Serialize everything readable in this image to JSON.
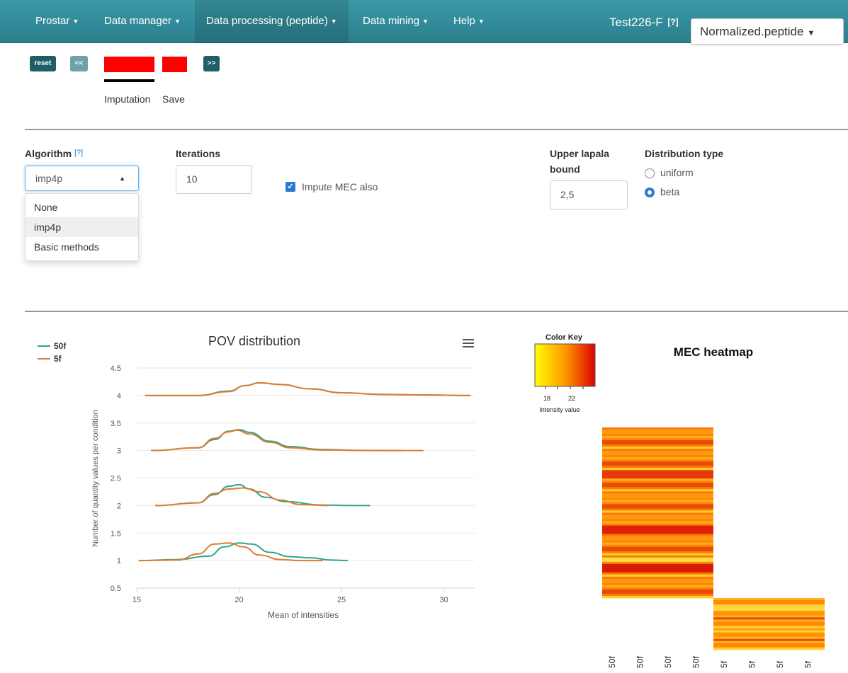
{
  "navbar": {
    "items": [
      {
        "label": "Prostar"
      },
      {
        "label": "Data manager"
      },
      {
        "label": "Data processing (peptide)"
      },
      {
        "label": "Data mining"
      },
      {
        "label": "Help"
      }
    ],
    "project_name": "Test226-F",
    "project_help": "[?]",
    "dataset_selected": "Normalized.peptide",
    "caret_icon": "caret-down-icon"
  },
  "stepper": {
    "reset_label": "reset",
    "prev_label": "<<",
    "next_label": ">>",
    "steps": [
      {
        "label": "Imputation"
      },
      {
        "label": "Save"
      }
    ],
    "colors": {
      "step_active": "#ff0000",
      "button_dark": "#1f5e68",
      "button_light": "#6fa3aa"
    }
  },
  "form": {
    "algorithm": {
      "label": "Algorithm",
      "help": "[?]",
      "value": "imp4p",
      "options": [
        "None",
        "imp4p",
        "Basic methods"
      ]
    },
    "iterations": {
      "label": "Iterations",
      "value": "10"
    },
    "impute_mec": {
      "label": "Impute MEC also",
      "checked": true
    },
    "upper_bound": {
      "label_line1": "Upper lapala",
      "label_line2": "bound",
      "value": "2,5"
    },
    "distribution": {
      "label": "Distribution type",
      "options": [
        {
          "label": "uniform",
          "checked": false
        },
        {
          "label": "beta",
          "checked": true
        }
      ]
    }
  },
  "pov_chart": {
    "menu_icon": "hamburger-menu-icon",
    "chart_data": {
      "type": "line",
      "title": "POV distribution",
      "xlabel": "Mean of intensities",
      "ylabel": "Number of quantity values per condition",
      "xlim": [
        15,
        31.5
      ],
      "ylim": [
        0.5,
        4.5
      ],
      "xticks": [
        "15",
        "20",
        "25",
        "30"
      ],
      "yticks": [
        "0.5",
        "1",
        "1.5",
        "2",
        "2.5",
        "3",
        "3.5",
        "4",
        "4.5"
      ],
      "legend": {
        "position": "top-left"
      },
      "series": [
        {
          "name": "50f",
          "color": "#2aa88a",
          "groups": [
            {
              "level": 4,
              "x": [
                15.4,
                18,
                19.5,
                20.3,
                21,
                22,
                23.5,
                25,
                27,
                29,
                31.3
              ],
              "y": [
                4,
                4,
                4.08,
                4.18,
                4.23,
                4.2,
                4.12,
                4.05,
                4.02,
                4.01,
                4
              ]
            },
            {
              "level": 3,
              "x": [
                15.7,
                18,
                18.8,
                19.5,
                20,
                20.5,
                21.5,
                22.5,
                24,
                26,
                28
              ],
              "y": [
                3,
                3.05,
                3.2,
                3.35,
                3.38,
                3.33,
                3.17,
                3.07,
                3.02,
                3,
                3
              ]
            },
            {
              "level": 2,
              "x": [
                15.9,
                18,
                18.8,
                19.5,
                20,
                20.5,
                21.3,
                22.3,
                24,
                25.5,
                26.4
              ],
              "y": [
                2,
                2.05,
                2.2,
                2.35,
                2.38,
                2.3,
                2.15,
                2.07,
                2.01,
                2,
                2
              ]
            },
            {
              "level": 1,
              "x": [
                15.1,
                17,
                18.5,
                19.3,
                20,
                20.6,
                21.5,
                22.5,
                23.5,
                24.5,
                25.3
              ],
              "y": [
                1,
                1.02,
                1.08,
                1.25,
                1.32,
                1.3,
                1.15,
                1.07,
                1.05,
                1.01,
                1
              ]
            }
          ]
        },
        {
          "name": "5f",
          "color": "#e07b30",
          "groups": [
            {
              "level": 4,
              "x": [
                15.4,
                18,
                19.5,
                20.3,
                21,
                22,
                23.5,
                25,
                27,
                29,
                31.3
              ],
              "y": [
                4,
                4,
                4.07,
                4.18,
                4.23,
                4.2,
                4.12,
                4.05,
                4.02,
                4.01,
                4
              ]
            },
            {
              "level": 3,
              "x": [
                15.7,
                18,
                18.8,
                19.5,
                19.9,
                20.5,
                21.5,
                22.5,
                24,
                27,
                29
              ],
              "y": [
                3,
                3.05,
                3.22,
                3.34,
                3.37,
                3.3,
                3.15,
                3.05,
                3.01,
                3,
                3
              ]
            },
            {
              "level": 2,
              "x": [
                15.9,
                18,
                18.8,
                19.5,
                20.2,
                21,
                22,
                23,
                24.4
              ],
              "y": [
                2,
                2.05,
                2.22,
                2.3,
                2.32,
                2.25,
                2.1,
                2.02,
                2
              ]
            },
            {
              "level": 1,
              "x": [
                15.1,
                17,
                18,
                18.8,
                19.5,
                20.2,
                21,
                22,
                23,
                24.1
              ],
              "y": [
                1,
                1.01,
                1.12,
                1.3,
                1.32,
                1.25,
                1.1,
                1.02,
                1,
                1
              ]
            }
          ]
        }
      ]
    }
  },
  "mec_heatmap": {
    "color_key": {
      "title": "Color Key",
      "ticks": [
        "18",
        "22"
      ],
      "xlabel": "Intensity value",
      "colors": [
        "#ffff00",
        "#ff9900",
        "#dd0000"
      ]
    },
    "chart_data": {
      "type": "heatmap",
      "title": "MEC heatmap",
      "columns": [
        "50f",
        "50f",
        "50f",
        "50f",
        "5f",
        "5f",
        "5f",
        "5f"
      ]
    }
  }
}
